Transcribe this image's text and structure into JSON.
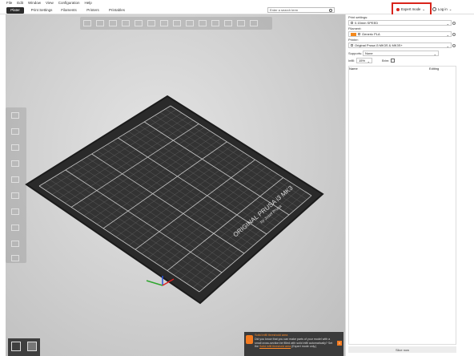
{
  "menu": [
    "File",
    "Edit",
    "Window",
    "View",
    "Configuration",
    "Help"
  ],
  "tabs": [
    "Plater",
    "Print Settings",
    "Filaments",
    "Printers",
    "Printables"
  ],
  "search": {
    "placeholder": "Enter a search term"
  },
  "mode": {
    "label": "Expert mode",
    "color": "#d9241b"
  },
  "account": {
    "label": "Log in"
  },
  "panel": {
    "print_settings_label": "Print settings:",
    "print_settings_value": "0.15mm SPEED",
    "filament_label": "Filament:",
    "filament_value": "Generic PLA",
    "filament_color": "#f5891c",
    "printer_label": "Printer:",
    "printer_value": "Original Prusa i3 MK3S & MK3S+",
    "supports_label": "Supports:",
    "supports_value": "None",
    "infill_label": "Infill:",
    "infill_value": "15%",
    "brim_label": "Brim:",
    "list_headers": [
      "Name",
      "Editing"
    ],
    "slice_label": "Slice now"
  },
  "bed": {
    "brand_line1": "ORIGINAL PRUSA i3 MK3",
    "brand_line2": "by Josef Prusa"
  },
  "notification": {
    "title": "Solid infill threshold area",
    "body": "Did you know that you can make parts of your model with a small cross-section be filled with solid infill automatically? Set the",
    "link": "Solid infill threshold area",
    "suffix": "(Expert mode only.)",
    "accent": "#f47b20"
  },
  "icons": [
    "search-icon",
    "user-icon",
    "lock-icon",
    "close-icon",
    "cube-view-icon",
    "move-icon",
    "scale-icon",
    "rotate-icon",
    "place-on-face-icon",
    "cut-icon"
  ]
}
